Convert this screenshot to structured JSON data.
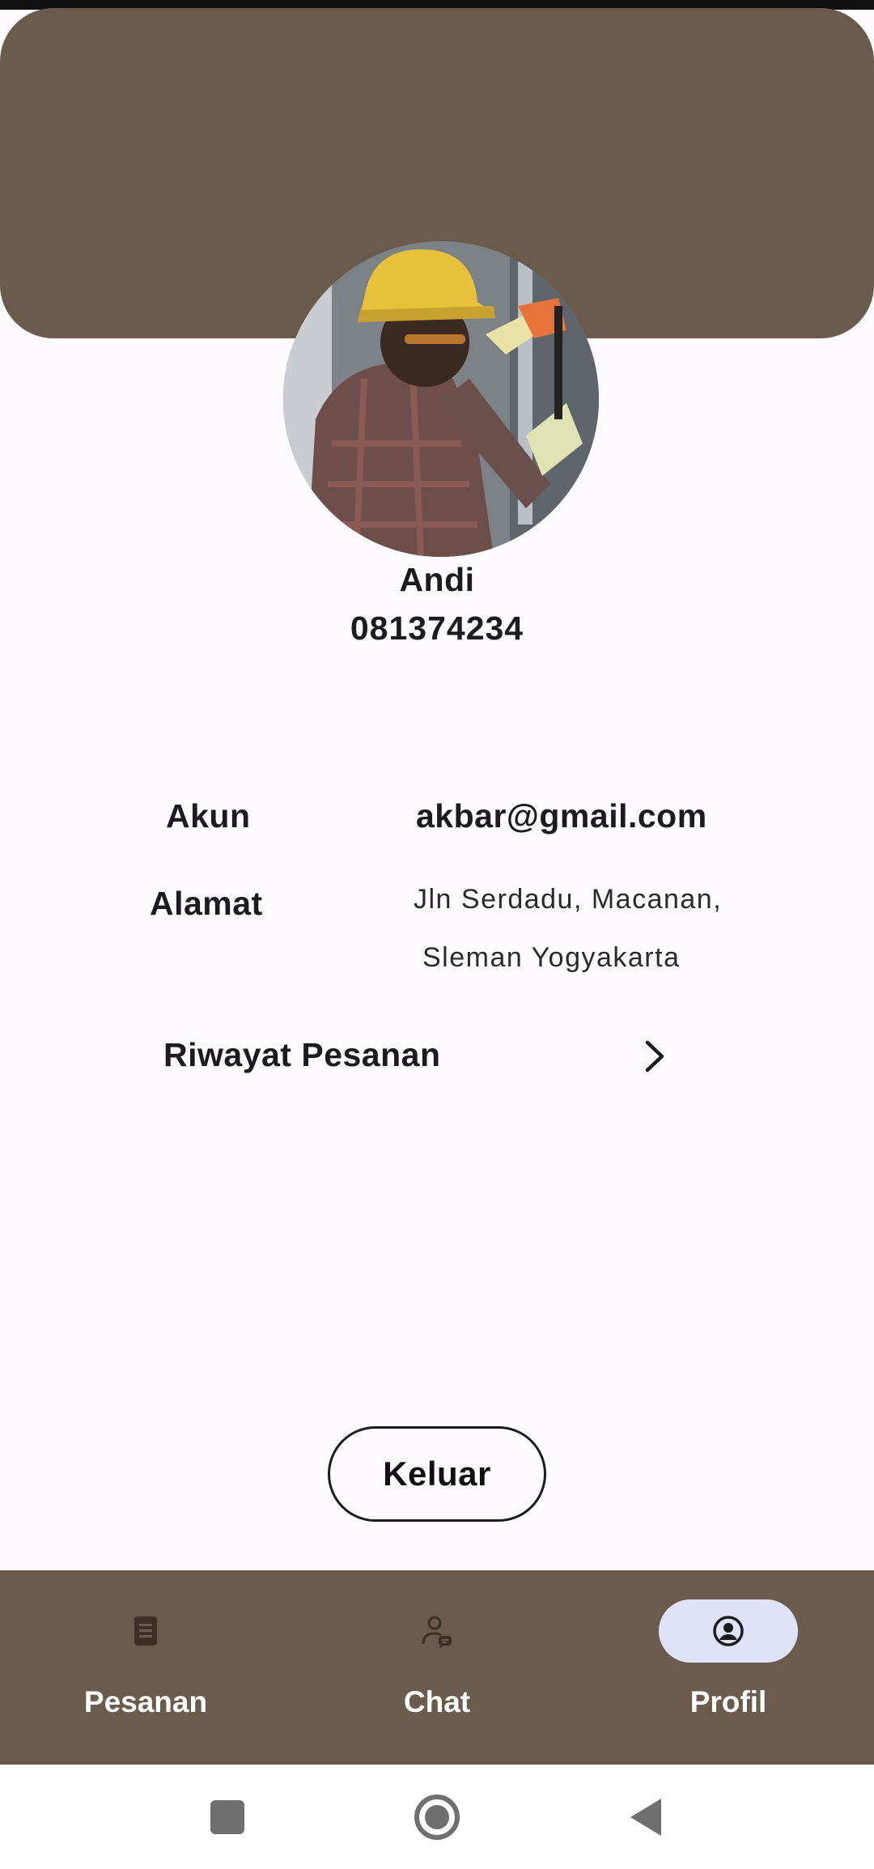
{
  "profile": {
    "name": "Andi",
    "phone": "081374234",
    "avatar_alt": "avatar-photo"
  },
  "details": {
    "account_label": "Akun",
    "account_value": "akbar@gmail.com",
    "address_label": "Alamat",
    "address_line1": "Jln Serdadu, Macanan,",
    "address_line2": "Sleman Yogyakarta"
  },
  "history": {
    "label": "Riwayat Pesanan",
    "icon": "chevron-right-icon"
  },
  "actions": {
    "logout_label": "Keluar"
  },
  "bottom_nav": {
    "items": [
      {
        "label": "Pesanan",
        "icon": "document-icon",
        "active": false
      },
      {
        "label": "Chat",
        "icon": "person-chat-icon",
        "active": false
      },
      {
        "label": "Profil",
        "icon": "account-circle-icon",
        "active": true
      }
    ]
  },
  "system_nav": {
    "recents_icon": "square-icon",
    "home_icon": "circle-icon",
    "back_icon": "triangle-back-icon"
  },
  "colors": {
    "header": "#6b5b4c",
    "nav_background": "#6b5b4c",
    "active_pill": "#dfe2f8",
    "page_background": "#fefbfe"
  }
}
